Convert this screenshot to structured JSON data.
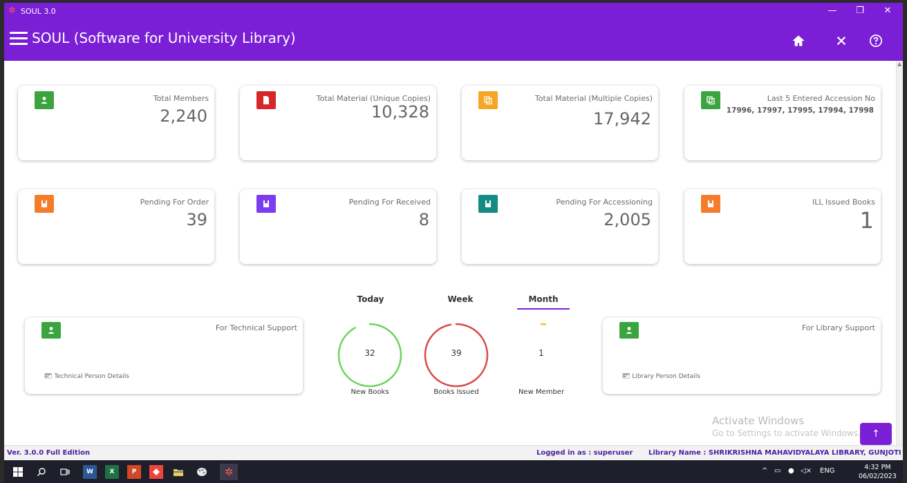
{
  "window": {
    "title": "SOUL 3.0",
    "minimize": "—",
    "maximize": "❐",
    "close": "✕"
  },
  "appbar": {
    "title": "SOUL (Software for University Library)",
    "icons": [
      "home-icon",
      "close-icon",
      "help-icon"
    ]
  },
  "colors": {
    "purple": "#7b1fd6",
    "green": "#3aa53f",
    "red": "#d62828",
    "amber": "#f6a623",
    "orange": "#f57c2b",
    "violet": "#7c3cf0",
    "teal": "#138c84"
  },
  "cards": [
    {
      "label": "Total Members",
      "value": "2,240",
      "icon": "person-icon",
      "color": "#3aa53f"
    },
    {
      "label": "Total Material (Unique Copies)",
      "value": "10,328",
      "icon": "document-icon",
      "color": "#d62828"
    },
    {
      "label": "Total Material (Multiple Copies)",
      "value": "17,942",
      "icon": "copy-icon",
      "color": "#f6a623"
    },
    {
      "label": "Last 5 Entered Accession No",
      "value": "17996, 17997, 17995, 17994, 17998",
      "icon": "copy-icon",
      "color": "#3aa53f"
    },
    {
      "label": "Pending For Order",
      "value": "39",
      "icon": "bookmark-icon",
      "color": "#f57c2b"
    },
    {
      "label": "Pending For Received",
      "value": "8",
      "icon": "bookmark-icon",
      "color": "#7c3cf0"
    },
    {
      "label": "Pending For Accessioning",
      "value": "2,005",
      "icon": "bookmark-icon",
      "color": "#138c84"
    },
    {
      "label": "ILL Issued Books",
      "value": "1",
      "icon": "bookmark-icon",
      "color": "#f57c2b"
    }
  ],
  "stats": {
    "tabs": [
      "Today",
      "Week",
      "Month"
    ],
    "active_tab": "Month",
    "items": [
      {
        "label": "New Books",
        "value": "32",
        "color": "#6fd35e",
        "fraction": 0.92
      },
      {
        "label": "Books Issued",
        "value": "39",
        "color": "#d94a4a",
        "fraction": 0.97
      },
      {
        "label": "New Member",
        "value": "1",
        "color": "#f2c029",
        "fraction": 0.02
      }
    ]
  },
  "support": {
    "technical": {
      "label": "For Technical Support",
      "details": "Technical Person Details"
    },
    "library": {
      "label": "For Library Support",
      "details": "Library Person Details"
    }
  },
  "watermark": {
    "line1": "Activate Windows",
    "line2": "Go to Settings to activate Windows."
  },
  "status": {
    "version": "Ver. 3.0.0  Full Edition",
    "logged_in": "Logged in as : superuser",
    "library": "Library Name : SHRIKRISHNA MAHAVIDYALAYA LIBRARY, GUNJOTI"
  },
  "taskbar": {
    "apps": [
      "windows-icon",
      "search-icon",
      "task-view-icon",
      "word-icon",
      "excel-icon",
      "powerpoint-icon",
      "anydesk-icon",
      "file-explorer-icon",
      "paint-icon",
      "soul-icon"
    ],
    "word_label": "W",
    "excel_label": "X",
    "ppt_label": "P",
    "lang": "ENG",
    "time": "4:32 PM",
    "date": "06/02/2023"
  }
}
